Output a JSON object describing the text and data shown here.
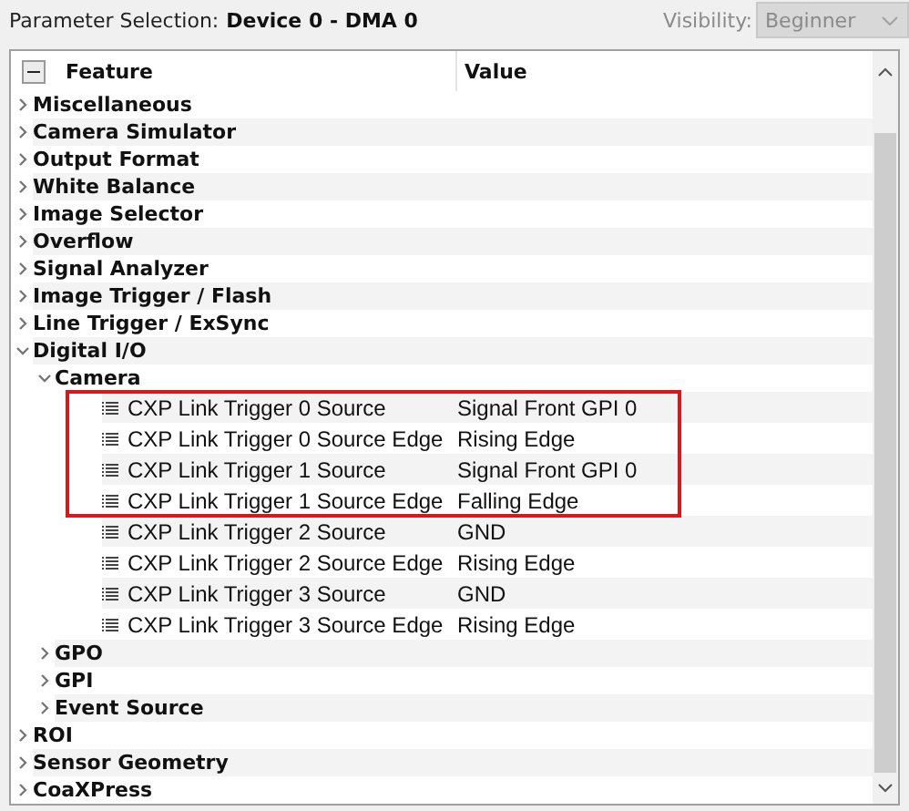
{
  "toolbar": {
    "label": "Parameter Selection:",
    "device": "Device 0 - DMA 0",
    "visibility": {
      "label": "Visibility:",
      "value": "Beginner",
      "disabled": true
    }
  },
  "table": {
    "columns": [
      "Feature",
      "Value"
    ],
    "rows": [
      {
        "label": "Miscellaneous",
        "kind": "category",
        "expanded": false
      },
      {
        "label": "Camera Simulator",
        "kind": "category",
        "expanded": false
      },
      {
        "label": "Output Format",
        "kind": "category",
        "expanded": false
      },
      {
        "label": "White Balance",
        "kind": "category",
        "expanded": false
      },
      {
        "label": "Image Selector",
        "kind": "category",
        "expanded": false
      },
      {
        "label": "Overflow",
        "kind": "category",
        "expanded": false
      },
      {
        "label": "Signal Analyzer",
        "kind": "category",
        "expanded": false
      },
      {
        "label": "Image Trigger / Flash",
        "kind": "category",
        "expanded": false
      },
      {
        "label": "Line Trigger / ExSync",
        "kind": "category",
        "expanded": false
      },
      {
        "label": "Digital I/O",
        "kind": "category",
        "expanded": true,
        "children": [
          {
            "label": "Camera",
            "kind": "category",
            "expanded": true,
            "children": [
              {
                "label": "CXP Link Trigger 0 Source",
                "kind": "parameter",
                "value": "Signal Front GPI 0",
                "highlighted": true
              },
              {
                "label": "CXP Link Trigger 0 Source Edge",
                "kind": "parameter",
                "value": "Rising Edge",
                "highlighted": true
              },
              {
                "label": "CXP Link Trigger 1 Source",
                "kind": "parameter",
                "value": "Signal Front GPI 0",
                "highlighted": true
              },
              {
                "label": "CXP Link Trigger 1 Source Edge",
                "kind": "parameter",
                "value": "Falling Edge",
                "highlighted": true
              },
              {
                "label": "CXP Link Trigger 2 Source",
                "kind": "parameter",
                "value": "GND",
                "highlighted": false
              },
              {
                "label": "CXP Link Trigger 2 Source Edge",
                "kind": "parameter",
                "value": "Rising Edge",
                "highlighted": false
              },
              {
                "label": "CXP Link Trigger 3 Source",
                "kind": "parameter",
                "value": "GND",
                "highlighted": false
              },
              {
                "label": "CXP Link Trigger 3 Source Edge",
                "kind": "parameter",
                "value": "Rising Edge",
                "highlighted": false
              }
            ]
          },
          {
            "label": "GPO",
            "kind": "category",
            "expanded": false
          },
          {
            "label": "GPI",
            "kind": "category",
            "expanded": false
          },
          {
            "label": "Event Source",
            "kind": "category",
            "expanded": false
          }
        ]
      },
      {
        "label": "ROI",
        "kind": "category",
        "expanded": false
      },
      {
        "label": "Sensor Geometry",
        "kind": "category",
        "expanded": false
      },
      {
        "label": "CoaXPress",
        "kind": "category",
        "expanded": false
      }
    ]
  }
}
